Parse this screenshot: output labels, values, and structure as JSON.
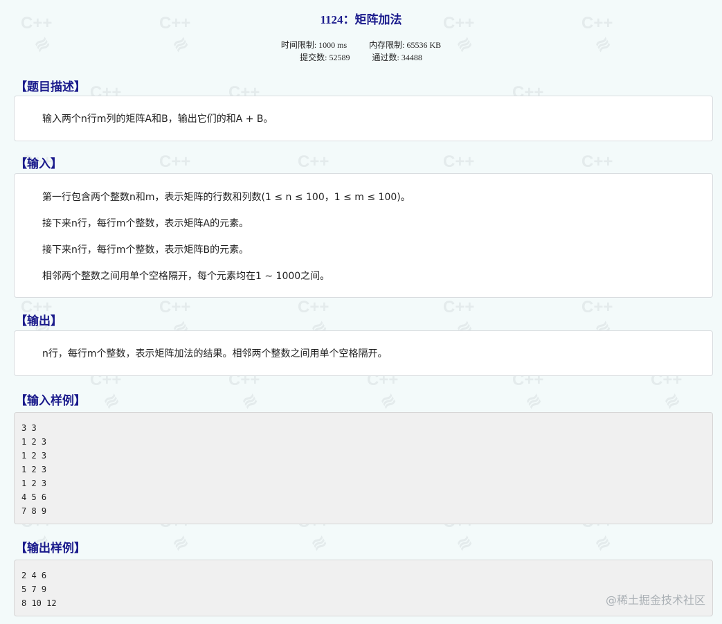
{
  "problem": {
    "id": "1124",
    "title": "矩阵加法",
    "time_limit": "时间限制: 1000 ms",
    "memory_limit": "内存限制: 65536 KB",
    "submissions": "提交数: 52589",
    "accepted": "通过数: 34488"
  },
  "sections": {
    "desc": {
      "title": "【题目描述】",
      "text": "输入两个n行m列的矩阵A和B，输出它们的和A + B。"
    },
    "input": {
      "title": "【输入】",
      "lines": [
        "第一行包含两个整数n和m，表示矩阵的行数和列数(1 ≤ n ≤ 100，1 ≤ m ≤ 100)。",
        "接下来n行，每行m个整数，表示矩阵A的元素。",
        "接下来n行，每行m个整数，表示矩阵B的元素。",
        "相邻两个整数之间用单个空格隔开，每个元素均在1 ∼ 1000之间。"
      ]
    },
    "output": {
      "title": "【输出】",
      "text": "n行，每行m个整数，表示矩阵加法的结果。相邻两个整数之间用单个空格隔开。"
    },
    "sample_input": {
      "title": "【输入样例】",
      "code": "3 3\n1 2 3\n1 2 3\n1 2 3\n1 2 3\n4 5 6\n7 8 9"
    },
    "sample_output": {
      "title": "【输出样例】",
      "code": "2 4 6\n5 7 9\n8 10 12"
    }
  },
  "watermark": {
    "text": "C++",
    "glyph": "≋"
  },
  "footer": {
    "mark": "@稀土掘金技术社区"
  },
  "colors": {
    "heading": "#1a1a8c",
    "background": "#f3fafa"
  }
}
